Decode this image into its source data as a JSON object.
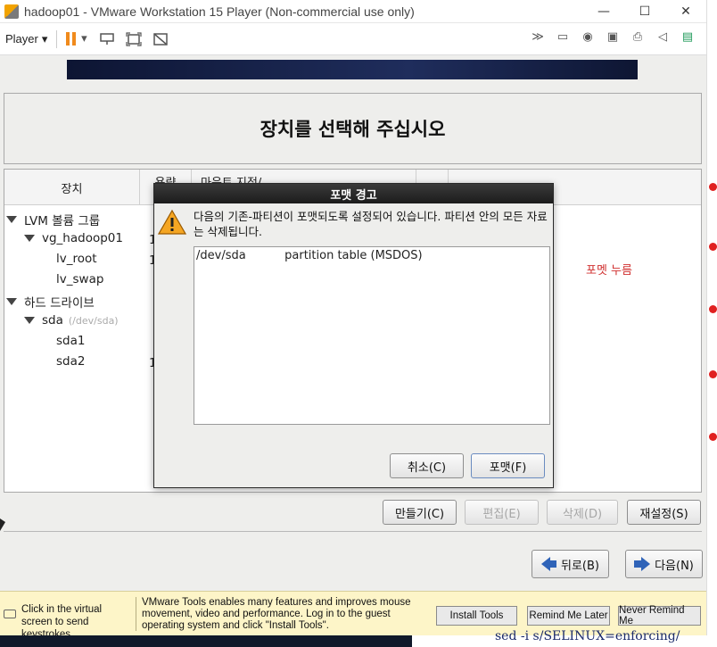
{
  "window": {
    "title": "hadoop01 - VMware Workstation 15 Player (Non-commercial use only)",
    "minimize": "—",
    "maximize": "☐",
    "close": "✕"
  },
  "toolbar": {
    "player_label": "Player",
    "dropdown_glyph": "▾",
    "icons_left": [
      "pause-icon",
      "send-ctrl-alt-del-icon",
      "fit-guest-icon",
      "unity-icon"
    ],
    "icons_right": [
      "more-icon",
      "hard-disk-icon",
      "cd-icon",
      "network-icon",
      "printer-icon",
      "sound-icon",
      "vm-library-icon"
    ]
  },
  "installer": {
    "heading": "장치를 선택해 주십시오",
    "columns": {
      "device": "장치",
      "capacity": "용량",
      "mount": "마운트 지점/"
    },
    "tree": [
      {
        "label": "LVM 볼륨 그룹",
        "level": 0,
        "expanded": true,
        "value": ""
      },
      {
        "label": "vg_hadoop01",
        "level": 1,
        "expanded": true,
        "value": "1"
      },
      {
        "label": "lv_root",
        "level": 2,
        "value": "1"
      },
      {
        "label": "lv_swap",
        "level": 2,
        "value": ""
      },
      {
        "label": "하드 드라이브",
        "level": 0,
        "expanded": true,
        "value": ""
      },
      {
        "label": "sda",
        "sublabel": "(/dev/sda)",
        "level": 1,
        "expanded": true,
        "value": ""
      },
      {
        "label": "sda1",
        "level": 2,
        "value": ""
      },
      {
        "label": "sda2",
        "level": 2,
        "value": "1"
      }
    ],
    "annotation": "포멧 누름",
    "buttons": {
      "create": "만들기(C)",
      "edit": "편집(E)",
      "delete": "삭제(D)",
      "reset": "재설정(S)",
      "back": "뒤로(B)",
      "next": "다음(N)"
    }
  },
  "dialog": {
    "title": "포맷 경고",
    "message": "다음의 기존-파티션이 포맷되도록 설정되어 있습니다. 파티션 안의 모든 자료는 삭제됩니다.",
    "items": [
      {
        "device": "/dev/sda",
        "description": "partition table (MSDOS)"
      }
    ],
    "cancel": "취소(C)",
    "format": "포맷(F)"
  },
  "notification": {
    "hint": "Click in the virtual screen to send keystrokes",
    "message": "VMware Tools enables many features and improves mouse movement, video and performance. Log in to the guest operating system and click \"Install Tools\".",
    "install": "Install Tools",
    "remind_later": "Remind Me Later",
    "never_remind": "Never Remind Me"
  },
  "background_text": "sed -i s/SELINUX=enforcing/"
}
